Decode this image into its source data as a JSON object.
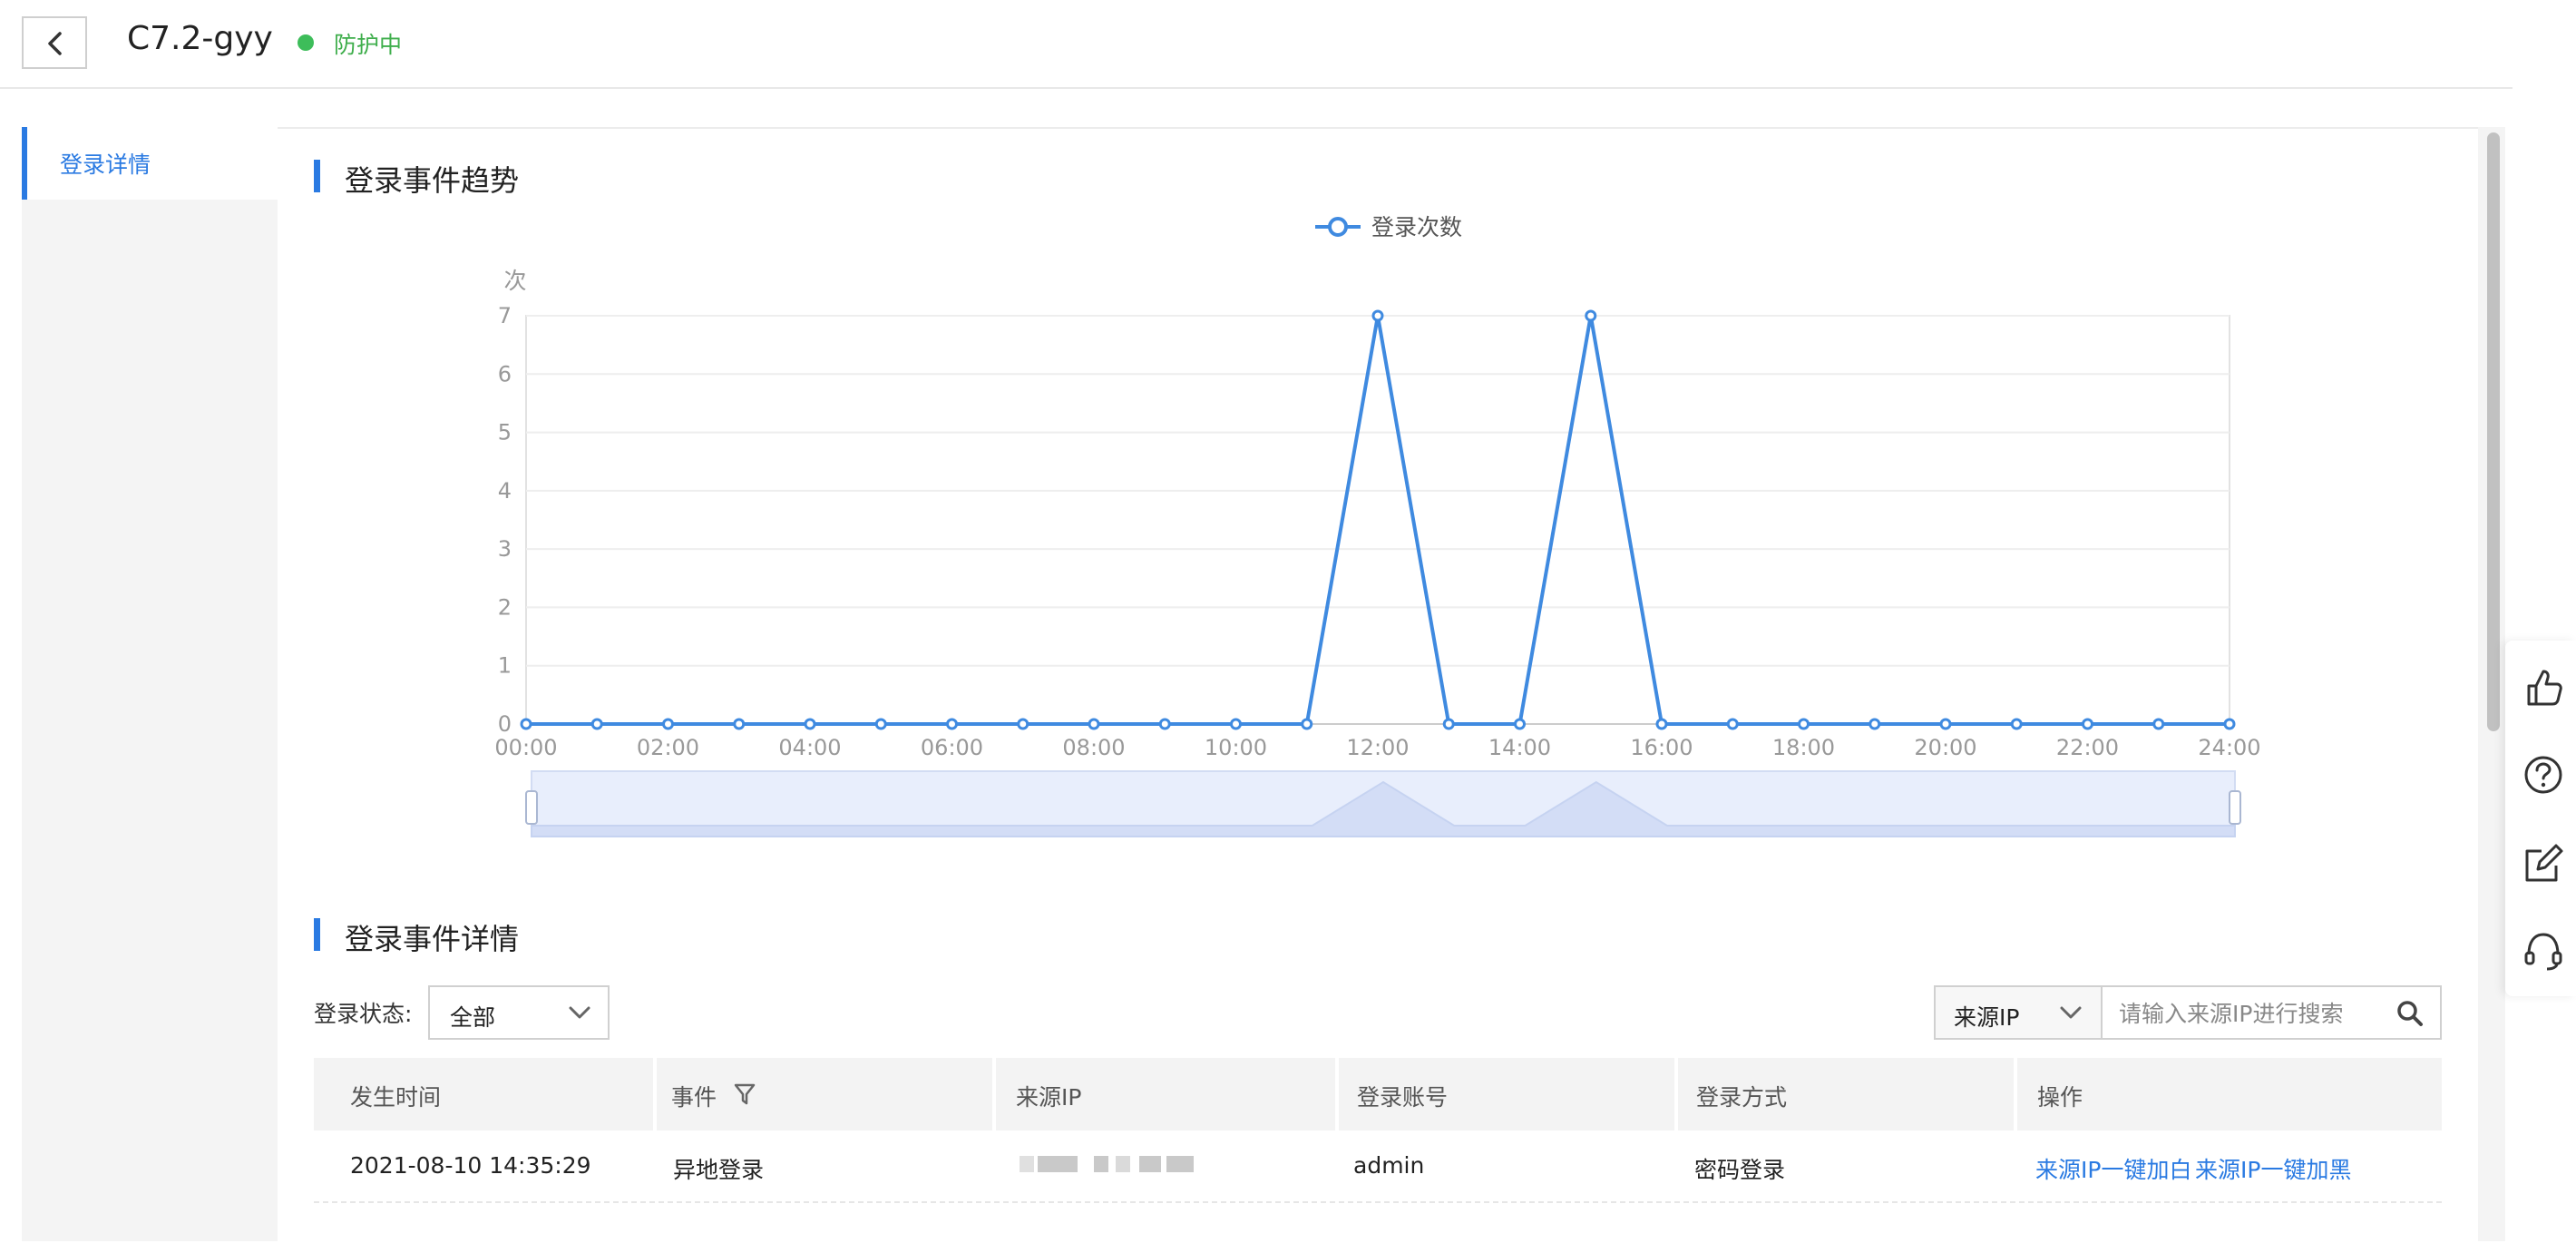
{
  "header": {
    "title": "C7.2-gyy",
    "status": "防护中",
    "status_color": "#3dbd5a"
  },
  "sidebar": {
    "items": [
      {
        "label": "登录详情",
        "active": true
      }
    ]
  },
  "sections": {
    "trend_title": "登录事件趋势",
    "detail_title": "登录事件详情"
  },
  "chart_data": {
    "type": "line",
    "legend": "登录次数",
    "legend_position": "top-center",
    "ylabel": "次",
    "ylim": [
      0,
      7
    ],
    "yticks": [
      "0",
      "1",
      "2",
      "3",
      "4",
      "5",
      "6",
      "7"
    ],
    "xtick_labels": [
      "00:00",
      "02:00",
      "04:00",
      "06:00",
      "08:00",
      "10:00",
      "12:00",
      "14:00",
      "16:00",
      "18:00",
      "20:00",
      "22:00",
      "24:00"
    ],
    "x": [
      0,
      1,
      2,
      3,
      4,
      5,
      6,
      7,
      8,
      9,
      10,
      11,
      12,
      13,
      14,
      15,
      16,
      17,
      18,
      19,
      20,
      21,
      22,
      23,
      24
    ],
    "series": [
      {
        "name": "登录次数",
        "values": [
          0,
          0,
          0,
          0,
          0,
          0,
          0,
          0,
          0,
          0,
          0,
          0,
          7,
          0,
          0,
          7,
          0,
          0,
          0,
          0,
          0,
          0,
          0,
          0,
          0
        ],
        "color": "#3f8ae0"
      }
    ],
    "grid": true
  },
  "filters": {
    "status_label": "登录状态:",
    "status_value": "全部",
    "search_type": "来源IP",
    "search_placeholder": "请输入来源IP进行搜索"
  },
  "table": {
    "columns": [
      "发生时间",
      "事件",
      "来源IP",
      "登录账号",
      "登录方式",
      "操作"
    ],
    "rows": [
      {
        "time": "2021-08-10 14:35:29",
        "event": "异地登录",
        "account": "admin",
        "method": "密码登录",
        "action_white": "来源IP一键加白",
        "action_black": "来源IP一键加黑"
      }
    ]
  },
  "colors": {
    "accent": "#2a7ae2"
  }
}
